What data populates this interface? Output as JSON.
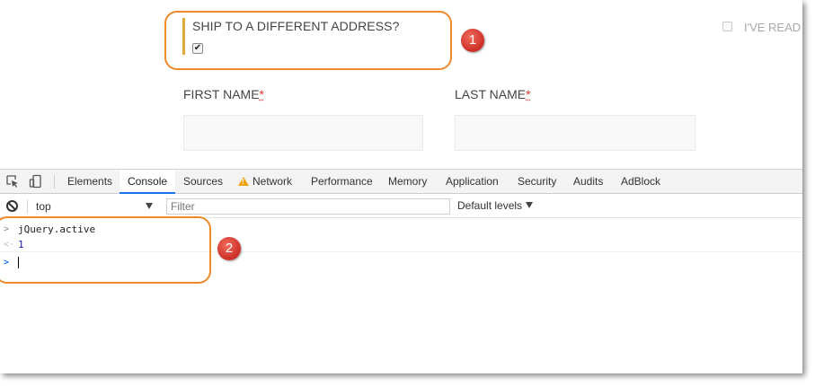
{
  "page": {
    "ship_label": "SHIP TO A DIFFERENT ADDRESS?",
    "ship_checked": "✔",
    "ive_read_label": "I'VE READ",
    "first_name_label": "FIRST NAME",
    "last_name_label": "LAST NAME",
    "required_marker": "*"
  },
  "devtools": {
    "tabs": [
      {
        "label": "Elements"
      },
      {
        "label": "Console"
      },
      {
        "label": "Sources"
      },
      {
        "label": "Network"
      },
      {
        "label": "Performance"
      },
      {
        "label": "Memory"
      },
      {
        "label": "Application"
      },
      {
        "label": "Security"
      },
      {
        "label": "Audits"
      },
      {
        "label": "AdBlock"
      }
    ],
    "active_tab": "Console",
    "context": "top",
    "filter_placeholder": "Filter",
    "levels_label": "Default levels",
    "console_lines": [
      {
        "prefix": ">",
        "text": "jQuery.active"
      },
      {
        "prefix": "<·",
        "text": "1"
      },
      {
        "prefix": ">",
        "text": ""
      }
    ]
  },
  "annotations": {
    "badge_1": "1",
    "badge_2": "2",
    "highlight_color": "#ef8a2c",
    "badge_color": "#d9352b"
  },
  "colors": {
    "accent_bar": "#e0a93a",
    "required": "#e23636",
    "active_tab_underline": "#1a73e8",
    "console_result": "#1a1aa6"
  },
  "icons": [
    "inspect-element-icon",
    "device-toolbar-icon",
    "warning-icon",
    "clear-console-icon",
    "dropdown-arrow-icon"
  ]
}
